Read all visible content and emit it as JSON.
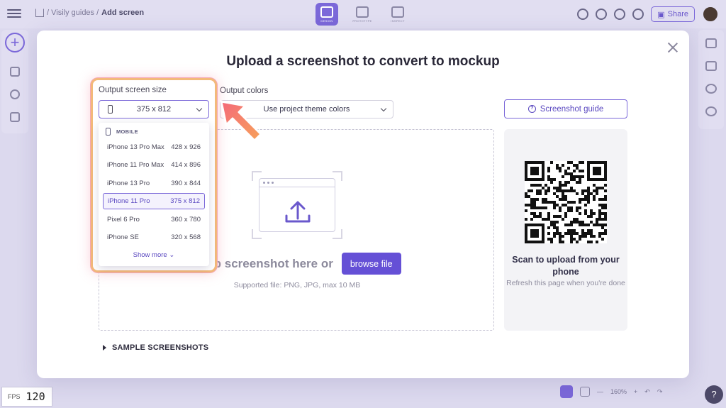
{
  "topbar": {
    "breadcrumb_project": "/ Visily guides /",
    "breadcrumb_current": "Add screen",
    "modes": [
      "DESIGN",
      "PROTOTYPE",
      "INSPECT"
    ],
    "share_label": "Share"
  },
  "modal": {
    "title": "Upload a screenshot to convert to mockup",
    "output_size_label": "Output screen size",
    "output_size_value": "375 x 812",
    "output_colors_label": "Output colors",
    "output_colors_value": "Use project theme colors",
    "guide_button": "Screenshot guide",
    "drop_text": "Drop screenshot here or",
    "browse_button": "browse file",
    "supported_text": "Supported file: PNG, JPG, max 10 MB",
    "qr_title": "Scan to upload from your phone",
    "qr_subtitle": "Refresh this page when you're done",
    "sample_label": "SAMPLE SCREENSHOTS"
  },
  "dropdown": {
    "group": "MOBILE",
    "items": [
      {
        "name": "iPhone 13 Pro Max",
        "size": "428 x 926"
      },
      {
        "name": "iPhone 11 Pro Max",
        "size": "414 x 896"
      },
      {
        "name": "iPhone 13 Pro",
        "size": "390 x 844"
      },
      {
        "name": "iPhone 11 Pro",
        "size": "375 x 812"
      },
      {
        "name": "Pixel 6 Pro",
        "size": "360 x 780"
      },
      {
        "name": "iPhone SE",
        "size": "320 x 568"
      }
    ],
    "selected_index": 3,
    "show_more": "Show more"
  },
  "status": {
    "fps_label": "FPS",
    "fps_value": "120",
    "zoom": "160%"
  },
  "colors": {
    "accent": "#6550d6",
    "highlight_border": "#f3b97a",
    "arrow": "#f4865a"
  }
}
